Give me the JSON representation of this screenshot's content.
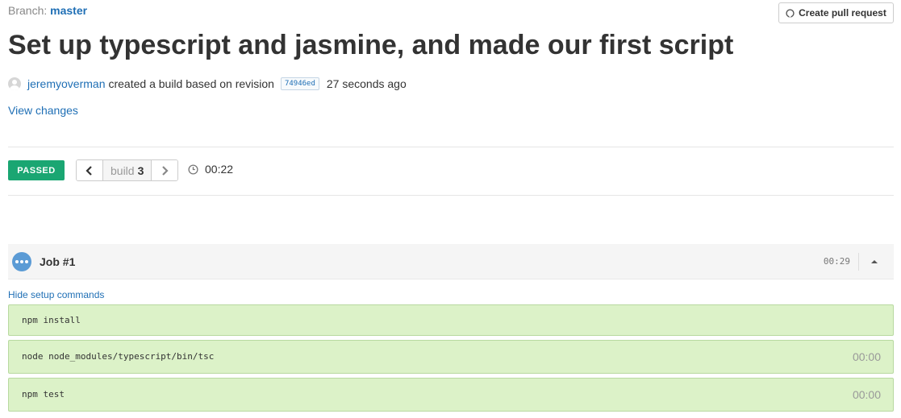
{
  "branch": {
    "label": "Branch:",
    "name": "master"
  },
  "header": {
    "create_pr_label": "Create pull request",
    "title": "Set up typescript and jasmine, and made our first script"
  },
  "meta": {
    "user": "jeremyoverman",
    "action": "created a build based on revision",
    "revision": "74946ed",
    "time_ago": "27 seconds ago"
  },
  "view_changes_label": "View changes",
  "build": {
    "status": "PASSED",
    "label": "build",
    "number": "3",
    "duration": "00:22"
  },
  "job": {
    "title": "Job #1",
    "time": "00:29"
  },
  "hide_setup_label": "Hide setup commands",
  "commands": [
    {
      "text": "npm install",
      "time": ""
    },
    {
      "text": "node node_modules/typescript/bin/tsc",
      "time": "00:00"
    },
    {
      "text": "npm test",
      "time": "00:00"
    }
  ],
  "colors": {
    "passed": "#1aa672",
    "link": "#1f6fb5",
    "command_bg": "#dcf2c8",
    "job_dot": "#5b9bd5"
  },
  "icons": {
    "pr": "github-icon",
    "clock": "clock-icon",
    "prev": "chevron-left-icon",
    "next": "chevron-right-icon",
    "toggle": "chevron-up-icon"
  }
}
